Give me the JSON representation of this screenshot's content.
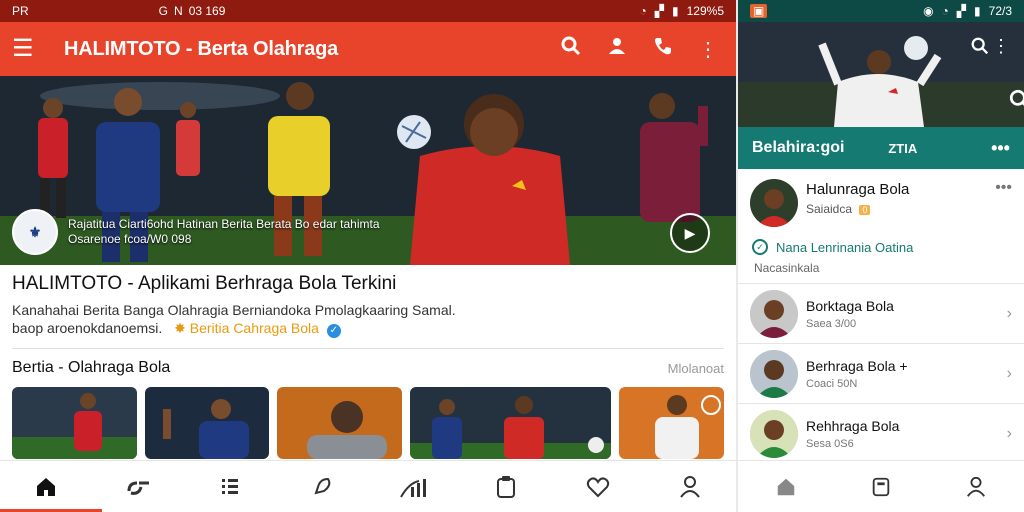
{
  "left": {
    "status": {
      "left": "PR",
      "mid": [
        "G",
        "N",
        "03 169"
      ],
      "right": "129%5"
    },
    "appbar": {
      "title": "HALIMTOTO - Berta Olahraga"
    },
    "hero": {
      "caption_line1": "Rajatitua Ciarti6ohd Hatinan Berita Berata Bo edar tahimta",
      "caption_line2": "Osarenoe fcoa/W0 098"
    },
    "info": {
      "title": "HALIMTOTO - Aplikami Berhraga Bola Terkini",
      "desc_line1": "Kanahahai Berita Banga Olahragia Berniandoka Pmolagkaaring Samal.",
      "desc_line2": "baop aroenokdanoemsi.",
      "tag": "Beritia Cahraga Bola"
    },
    "section": {
      "title": "Bertia - Olahraga Bola",
      "more": "Mlolanoat"
    },
    "colors": {
      "accent": "#e8432b",
      "teal": "#147a72"
    }
  },
  "right": {
    "status": {
      "right": "72/3"
    },
    "tabbar": {
      "t1": "Belahira:goi",
      "t2": "ZTIA",
      "t3": "•••"
    },
    "profile": {
      "name": "Halunraga Bola",
      "sub": "Saiaidca",
      "badge": "0"
    },
    "notice": {
      "title": "Nana Lenrinania Oatina",
      "sub": "Nacasinkala"
    },
    "list": [
      {
        "title": "Borktaga Bola",
        "sub": "Saea 3/00"
      },
      {
        "title": "Berhraga Bola +",
        "sub": "Coaci 50N"
      },
      {
        "title": "Rehhraga Bola",
        "sub": "Sesa 0S6"
      }
    ]
  }
}
